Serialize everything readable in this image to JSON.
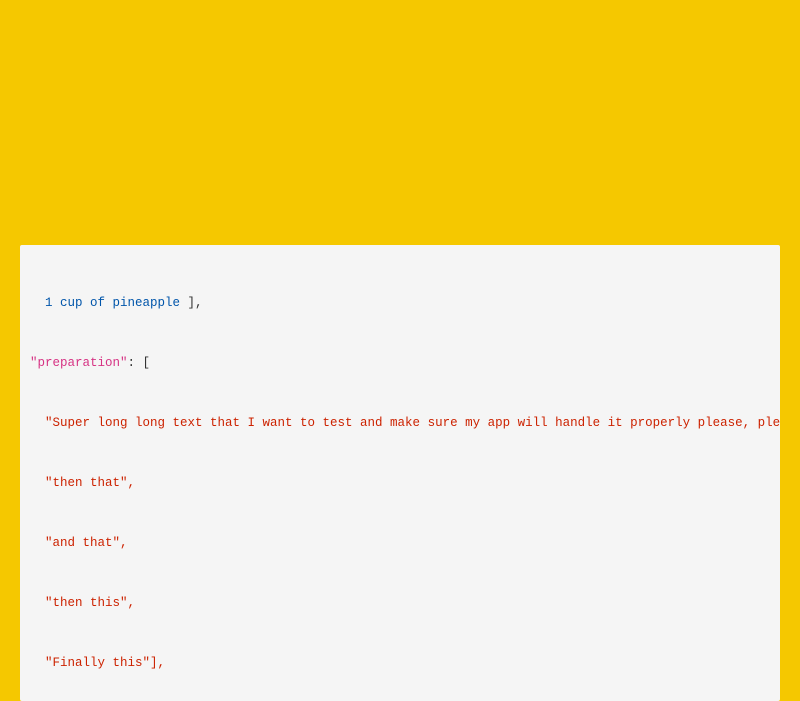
{
  "background_color": "#F5C800",
  "code_panel": {
    "lines": [
      {
        "id": "line1",
        "parts": [
          {
            "text": "  1 cup of pineapple",
            "color": "blue"
          },
          {
            "text": "],",
            "color": "dark"
          }
        ]
      },
      {
        "id": "line2",
        "parts": [
          {
            "text": "\"preparation\"",
            "color": "pink"
          },
          {
            "text": ": [",
            "color": "dark"
          }
        ]
      },
      {
        "id": "line3",
        "parts": [
          {
            "text": "  \"Super long long text that I want to test and make sure my app will handle it properly please, please work!!\",",
            "color": "string"
          }
        ]
      },
      {
        "id": "line4",
        "parts": [
          {
            "text": "  \"then that\",",
            "color": "string"
          }
        ]
      },
      {
        "id": "line5",
        "parts": [
          {
            "text": "  \"and that\",",
            "color": "string"
          }
        ]
      },
      {
        "id": "line6",
        "parts": [
          {
            "text": "  \"then this\",",
            "color": "string"
          }
        ]
      },
      {
        "id": "line7",
        "parts": [
          {
            "text": "  \"Finally this\"],",
            "color": "string"
          }
        ]
      }
    ]
  }
}
